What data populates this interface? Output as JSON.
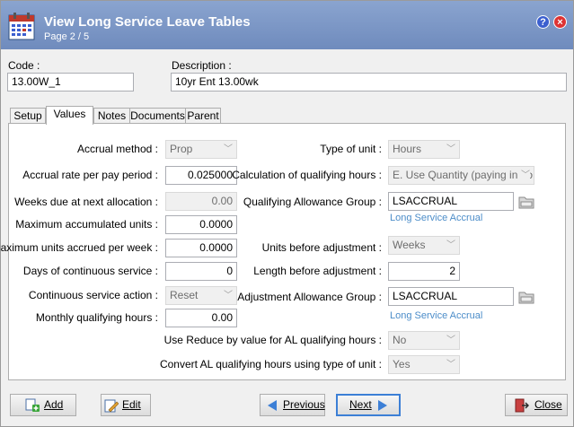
{
  "window": {
    "title": "View Long Service Leave Tables",
    "subtitle": "Page 2 / 5"
  },
  "header": {
    "code_label": "Code :",
    "code_value": "13.00W_1",
    "description_label": "Description :",
    "description_value": "10yr Ent 13.00wk"
  },
  "tabs": [
    {
      "label": "Setup"
    },
    {
      "label": "Values"
    },
    {
      "label": "Notes"
    },
    {
      "label": "Documents"
    },
    {
      "label": "Parent"
    }
  ],
  "left": {
    "accrual_method": {
      "label": "Accrual method :",
      "value": "Prop"
    },
    "accrual_rate": {
      "label": "Accrual rate per pay period :",
      "value": "0.025000"
    },
    "weeks_due": {
      "label": "Weeks due at next allocation :",
      "value": "0.00"
    },
    "max_accumulated": {
      "label": "Maximum accumulated units :",
      "value": "0.0000"
    },
    "max_per_week": {
      "label": "Maximum units accrued per week :",
      "value": "0.0000"
    },
    "days_continuous": {
      "label": "Days of continuous service :",
      "value": "0"
    },
    "continuous_action": {
      "label": "Continuous service action :",
      "value": "Reset"
    },
    "monthly_hours": {
      "label": "Monthly qualifying hours :",
      "value": "0.00"
    }
  },
  "right": {
    "type_of_unit": {
      "label": "Type of unit :",
      "value": "Hours"
    },
    "calc_qualifying": {
      "label": "Calculation of qualifying hours :",
      "value": "E. Use Quantity (paying in ho"
    },
    "qual_allowance": {
      "label": "Qualifying Allowance Group :",
      "value": "LSACCRUAL",
      "link": "Long Service Accrual"
    },
    "units_before": {
      "label": "Units before adjustment :",
      "value": "Weeks"
    },
    "length_before": {
      "label": "Length before adjustment :",
      "value": "2"
    },
    "adj_allowance": {
      "label": "Adjustment Allowance Group :",
      "value": "LSACCRUAL",
      "link": "Long Service Accrual"
    },
    "use_reduce": {
      "label": "Use Reduce by value for AL qualifying hours :",
      "value": "No"
    },
    "convert_al": {
      "label": "Convert AL qualifying hours using type of unit :",
      "value": "Yes"
    }
  },
  "buttons": {
    "add": "Add",
    "edit": "Edit",
    "previous": "Previous",
    "next": "Next",
    "close": "Close"
  },
  "icons": {
    "app": "calendar-icon",
    "help": "help-icon",
    "close": "close-icon",
    "lookup": "folder-lookup-icon"
  },
  "colors": {
    "titlebar": "#7b96c6",
    "link": "#4c8dc9",
    "focus": "#3c7fd6"
  }
}
